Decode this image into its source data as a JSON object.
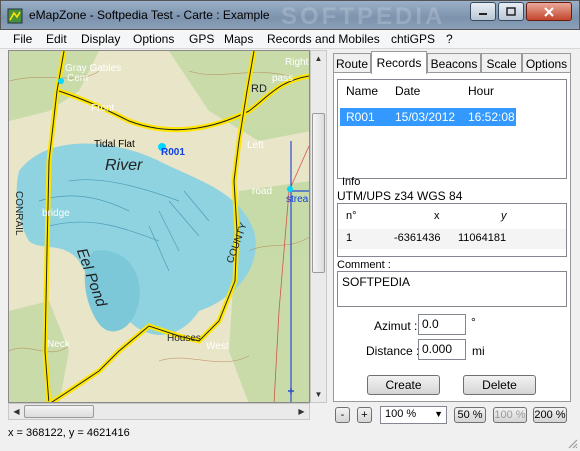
{
  "window": {
    "title": "eMapZone - Softpedia Test - Carte : Example",
    "watermark": "SOFTPEDIA"
  },
  "menu": [
    "File",
    "Edit",
    "Display",
    "Options",
    "GPS",
    "Maps",
    "Records and Mobiles",
    "chtiGPS",
    "?"
  ],
  "map": {
    "labels": [
      "Gray Gables",
      "Cem",
      "Front",
      "Tidal Flat",
      "R001",
      "River",
      "CONRAIL",
      "bridge",
      "Eel Pond",
      "COUNTY",
      "Houses",
      "West",
      "Neck",
      "Left",
      "Right",
      "pass",
      "road",
      "strea",
      "RD"
    ]
  },
  "tabs": [
    "Route",
    "Records",
    "Beacons",
    "Scale",
    "Options"
  ],
  "active_tab": "Records",
  "records": {
    "columns": [
      "Name",
      "Date",
      "Hour"
    ],
    "rows": [
      {
        "name": "R001",
        "date": "15/03/2012",
        "hour": "16:52:08"
      }
    ]
  },
  "info": {
    "label": "Info",
    "projection": "UTM/UPS z34 WGS 84",
    "columns": [
      "n°",
      "x",
      "y"
    ],
    "row": {
      "n": "1",
      "x": "-6361436",
      "y": "11064181"
    }
  },
  "comment": {
    "label": "Comment :",
    "value": "SOFTPEDIA"
  },
  "azimut": {
    "label": "Azimut :",
    "value": "0.0",
    "unit": "°"
  },
  "distance": {
    "label": "Distance :",
    "value": "0.000",
    "unit": "mi"
  },
  "buttons": {
    "create": "Create",
    "delete": "Delete"
  },
  "zoom_controls": {
    "minus": "-",
    "plus": "+",
    "zoom_value": "100 %",
    "z50": "50 %",
    "z100": "100 %",
    "z200": "200 %"
  },
  "status": "x = 368122, y = 4621416",
  "colors": {
    "selection": "#3399ff",
    "road": "#f2e600",
    "water": "#8fd3e0",
    "map_bg": "#e9e5c8"
  }
}
